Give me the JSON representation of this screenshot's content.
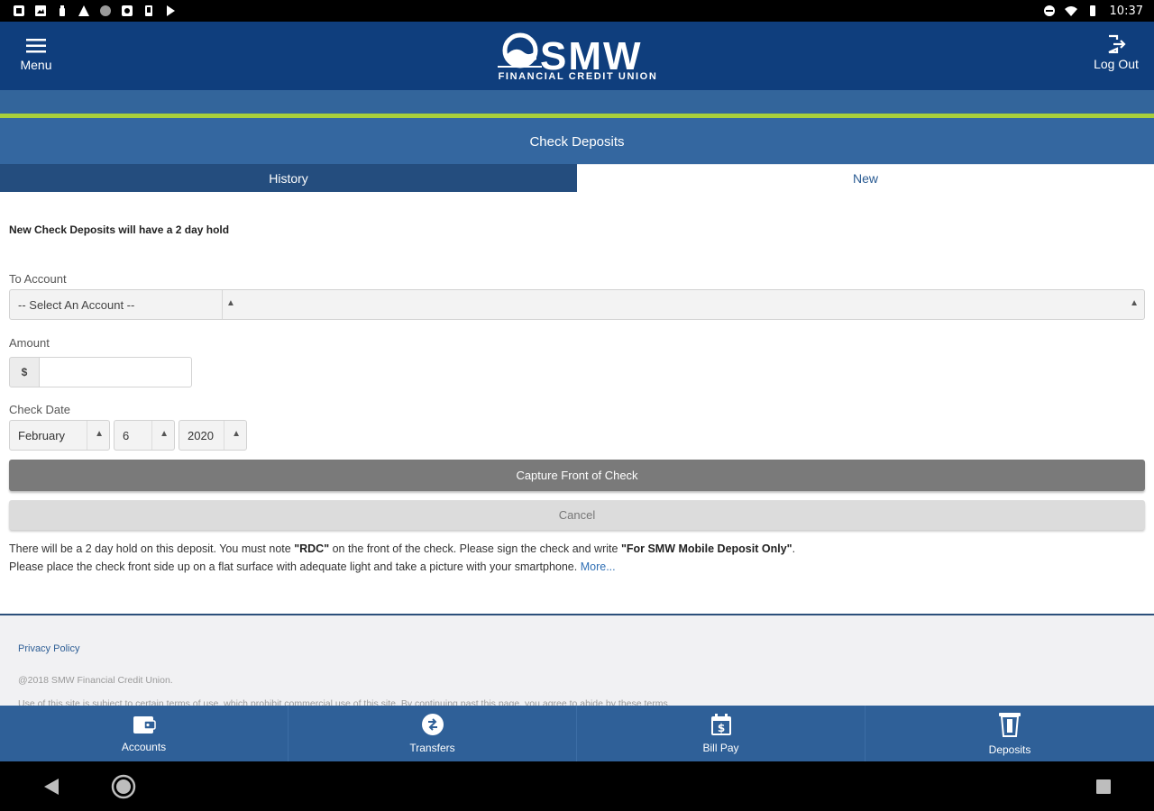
{
  "status_bar": {
    "time": "10:37"
  },
  "header": {
    "menu_label": "Menu",
    "logout_label": "Log Out",
    "logo_text": "SMW",
    "logo_subtitle": "FINANCIAL CREDIT UNION"
  },
  "page": {
    "title": "Check Deposits"
  },
  "tabs": [
    {
      "label": "History",
      "active": false
    },
    {
      "label": "New",
      "active": true
    }
  ],
  "form": {
    "hold_note": "New Check Deposits will have a 2 day hold",
    "to_account_label": "To Account",
    "to_account_value": "-- Select An Account --",
    "amount_label": "Amount",
    "currency_symbol": "$",
    "amount_value": "",
    "check_date_label": "Check Date",
    "month": "February",
    "day": "6",
    "year": "2020",
    "capture_button": "Capture Front of Check",
    "cancel_button": "Cancel"
  },
  "info": {
    "l1_a": "There will be a 2 day hold on this deposit. You must note ",
    "l1_b": "\"RDC\"",
    "l1_c": " on the front of the check. Please sign the check and write ",
    "l1_d": "\"For SMW Mobile Deposit Only\"",
    "l1_e": ".",
    "l2_a": "Please place the check front side up on a flat surface with adequate light and take a picture with your smartphone. ",
    "more_link": "More..."
  },
  "footer": {
    "privacy_policy": "Privacy Policy",
    "copyright": "@2018 SMW Financial Credit Union.",
    "terms": "Use of this site is subject to certain terms of use, which prohibit commercial use of this site. By continuing past this page, you agree to abide by these terms."
  },
  "bottom_nav": [
    {
      "label": "Accounts",
      "icon": "wallet-icon"
    },
    {
      "label": "Transfers",
      "icon": "transfer-icon"
    },
    {
      "label": "Bill Pay",
      "icon": "calendar-bill-icon"
    },
    {
      "label": "Deposits",
      "icon": "deposit-icon"
    }
  ],
  "colors": {
    "header_blue": "#0f3e7d",
    "title_blue": "#3467a0",
    "accent_green": "#a8cf3c",
    "nav_blue": "#2f6098",
    "capture_gray": "#7a7a7a"
  }
}
